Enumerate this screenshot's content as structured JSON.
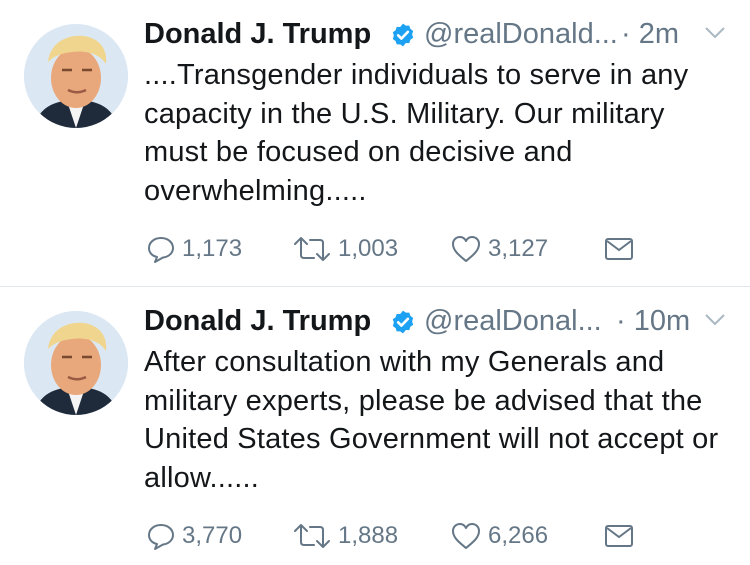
{
  "tweets": [
    {
      "author_name": "Donald J. Trump",
      "handle": "@realDonald...",
      "time": "· 2m",
      "text": "....Transgender individuals to  serve in any capacity in the U.S. Military. Our military must be focused on decisive and overwhelming.....",
      "replies": "1,173",
      "retweets": "1,003",
      "likes": "3,127"
    },
    {
      "author_name": "Donald J. Trump",
      "handle": "@realDonal...",
      "time": "· 10m",
      "text": "After consultation with my Generals and military experts, please be advised that the United States Government will not accept or allow......",
      "replies": "3,770",
      "retweets": "1,888",
      "likes": "6,266"
    }
  ],
  "colors": {
    "verified_badge": "#1da1f2",
    "secondary_text": "#657786",
    "primary_text": "#14171a",
    "divider": "#e1e8ed"
  },
  "icons": [
    "profile-avatar",
    "verified-badge-icon",
    "chevron-down-icon",
    "reply-icon",
    "retweet-icon",
    "like-icon",
    "direct-message-icon"
  ]
}
